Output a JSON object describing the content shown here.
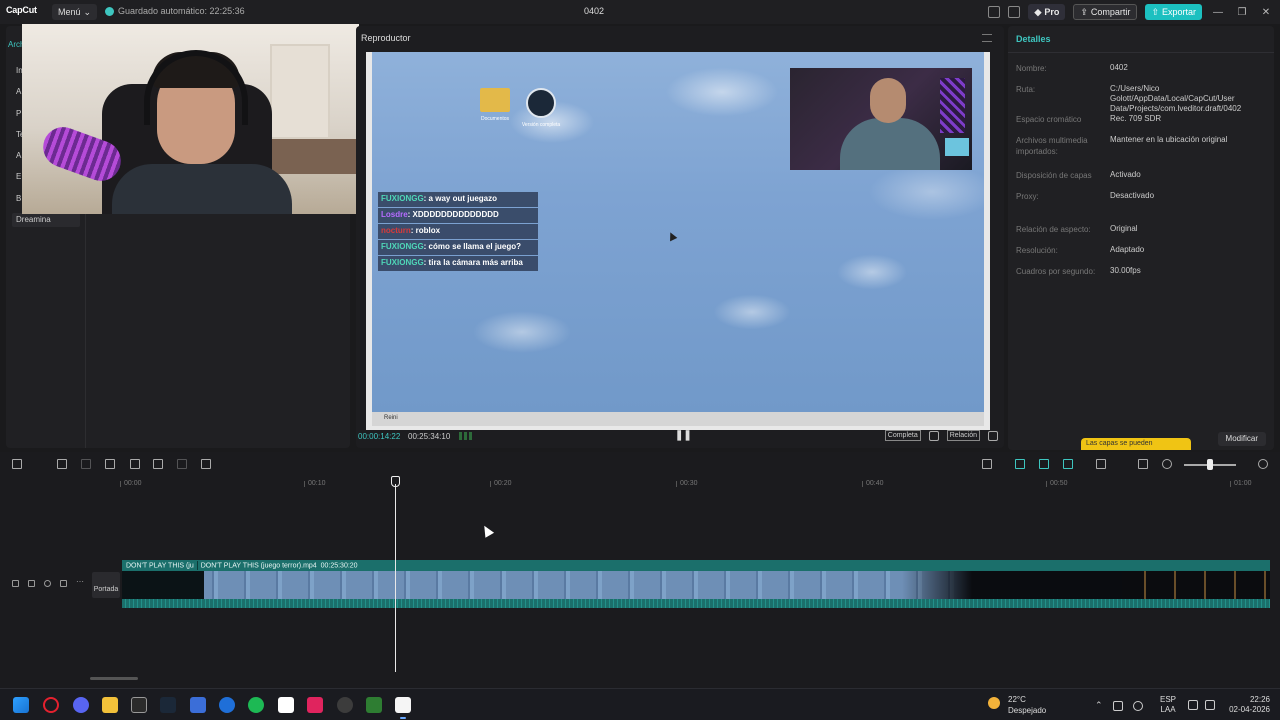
{
  "app": {
    "logo": "CapCut",
    "menu_label": "Menú",
    "autosave": "Guardado automático: 22:25:36",
    "project_title": "0402",
    "pro_label": "Pro",
    "share_label": "Compartir",
    "export_label": "Exportar",
    "accent": "#3ec6c0"
  },
  "left_nav": {
    "items": [
      "Arch",
      "In",
      "A",
      "P",
      "Te",
      "A",
      "E",
      "B"
    ],
    "dreamina": "Dreamina"
  },
  "player": {
    "title": "Reproductor",
    "current_time": "00:00:14:22",
    "total_time": "00:25:34:10",
    "full_label": "Completa",
    "ratio_label": "Relación",
    "desktop_icons": [
      {
        "label": "Documentos",
        "icon": "folder-icon"
      },
      {
        "label": "Versión completa",
        "icon": "steam-icon"
      }
    ],
    "chat": [
      {
        "user": "FUXIONGG",
        "text": ": a way out juegazo",
        "color": "teal"
      },
      {
        "user": "Losdre",
        "text": ": XDDDDDDDDDDDDDD",
        "color": "purple"
      },
      {
        "user": "nocturn",
        "text": ": roblox",
        "color": "red"
      },
      {
        "user": "FUXIONGG",
        "text": ": cómo se llama el juego?",
        "color": "teal"
      },
      {
        "user": "FUXIONGG",
        "text": ": tira la cámara más arriba",
        "color": "teal"
      }
    ],
    "mini_start": "Reini"
  },
  "details": {
    "title": "Detalles",
    "rows": [
      {
        "label": "Nombre:",
        "value": "0402"
      },
      {
        "label": "Ruta:",
        "value": "C:/Users/Nico Golott/AppData/Local/CapCut/User Data/Projects/com.lveditor.draft/0402"
      },
      {
        "label": "Espacio cromático",
        "value": "Rec. 709 SDR"
      },
      {
        "label": "Archivos multimedia importados:",
        "value": "Mantener en la ubicación original"
      },
      {
        "label": "Disposición de capas",
        "value": "Activado"
      },
      {
        "label": "Proxy:",
        "value": "Desactivado"
      },
      {
        "label": "Relación de aspecto:",
        "value": "Original"
      },
      {
        "label": "Resolución:",
        "value": "Adaptado"
      },
      {
        "label": "Cuadros por segundo:",
        "value": "30.00fps"
      }
    ],
    "modify_label": "Modificar",
    "toast": "Las capas se pueden"
  },
  "timeline": {
    "ticks": [
      "00:00",
      "00:10",
      "00:20",
      "00:30",
      "00:40",
      "00:50",
      "01:00"
    ],
    "clip_name_short": "DON'T PLAY THIS (ju",
    "clip_name": "DON'T PLAY THIS (juego terror).mp4",
    "clip_duration": "00:25:30:20",
    "cover_label": "Portada",
    "playhead_progress": 0.15
  },
  "taskbar": {
    "weather_temp": "22°C",
    "weather_desc": "Despejado",
    "lang_top": "ESP",
    "lang_bottom": "LAA",
    "time": "22:26",
    "date": "02-04-2026"
  }
}
